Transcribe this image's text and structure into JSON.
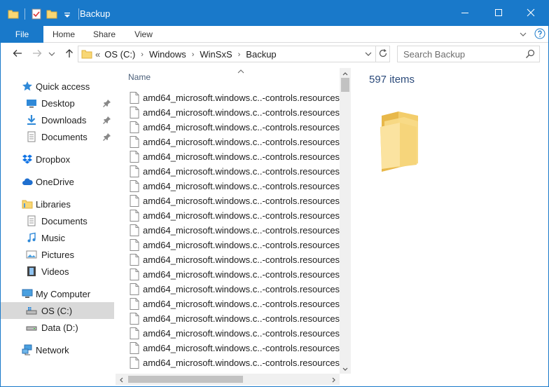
{
  "window": {
    "title": "Backup",
    "accent_color": "#1979ca",
    "controls": {
      "minimize": "minimize-icon",
      "maximize": "maximize-icon",
      "close": "close-icon"
    }
  },
  "quick_access_toolbar": {
    "icons": [
      "folder-icon",
      "properties-icon",
      "new-folder-icon",
      "customize-dropdown-icon"
    ]
  },
  "ribbon": {
    "tabs": [
      {
        "label": "File"
      },
      {
        "label": "Home"
      },
      {
        "label": "Share"
      },
      {
        "label": "View"
      }
    ]
  },
  "address_bar": {
    "overflow": "«",
    "crumbs": [
      "OS (C:)",
      "Windows",
      "WinSxS",
      "Backup"
    ]
  },
  "search": {
    "placeholder": "Search Backup"
  },
  "nav_pane": {
    "items": [
      {
        "label": "Quick access",
        "icon": "star-icon"
      },
      {
        "label": "Desktop",
        "icon": "desktop-icon",
        "pinned": true
      },
      {
        "label": "Downloads",
        "icon": "download-icon",
        "pinned": true
      },
      {
        "label": "Documents",
        "icon": "documents-icon",
        "pinned": true
      },
      {
        "label": "Dropbox",
        "icon": "dropbox-icon"
      },
      {
        "label": "OneDrive",
        "icon": "cloud-icon"
      },
      {
        "label": "Libraries",
        "icon": "libraries-icon"
      },
      {
        "label": "Documents",
        "icon": "documents-icon"
      },
      {
        "label": "Music",
        "icon": "music-icon"
      },
      {
        "label": "Pictures",
        "icon": "pictures-icon"
      },
      {
        "label": "Videos",
        "icon": "videos-icon"
      },
      {
        "label": "My Computer",
        "icon": "computer-icon"
      },
      {
        "label": "OS (C:)",
        "icon": "drive-icon",
        "selected": true
      },
      {
        "label": "Data (D:)",
        "icon": "drive-icon"
      },
      {
        "label": "Network",
        "icon": "network-icon"
      }
    ]
  },
  "file_list": {
    "column_name": "Name",
    "sorted": "ascending",
    "rows": [
      "amd64_microsoft.windows.c..-controls.resources",
      "amd64_microsoft.windows.c..-controls.resources",
      "amd64_microsoft.windows.c..-controls.resources",
      "amd64_microsoft.windows.c..-controls.resources",
      "amd64_microsoft.windows.c..-controls.resources",
      "amd64_microsoft.windows.c..-controls.resources",
      "amd64_microsoft.windows.c..-controls.resources",
      "amd64_microsoft.windows.c..-controls.resources",
      "amd64_microsoft.windows.c..-controls.resources",
      "amd64_microsoft.windows.c..-controls.resources",
      "amd64_microsoft.windows.c..-controls.resources",
      "amd64_microsoft.windows.c..-controls.resources",
      "amd64_microsoft.windows.c..-controls.resources",
      "amd64_microsoft.windows.c..-controls.resources",
      "amd64_microsoft.windows.c..-controls.resources",
      "amd64_microsoft.windows.c..-controls.resources",
      "amd64_microsoft.windows.c..-controls.resources",
      "amd64_microsoft.windows.c..-controls.resources",
      "amd64_microsoft.windows.c..-controls.resources"
    ]
  },
  "details": {
    "item_count": "597 items"
  }
}
